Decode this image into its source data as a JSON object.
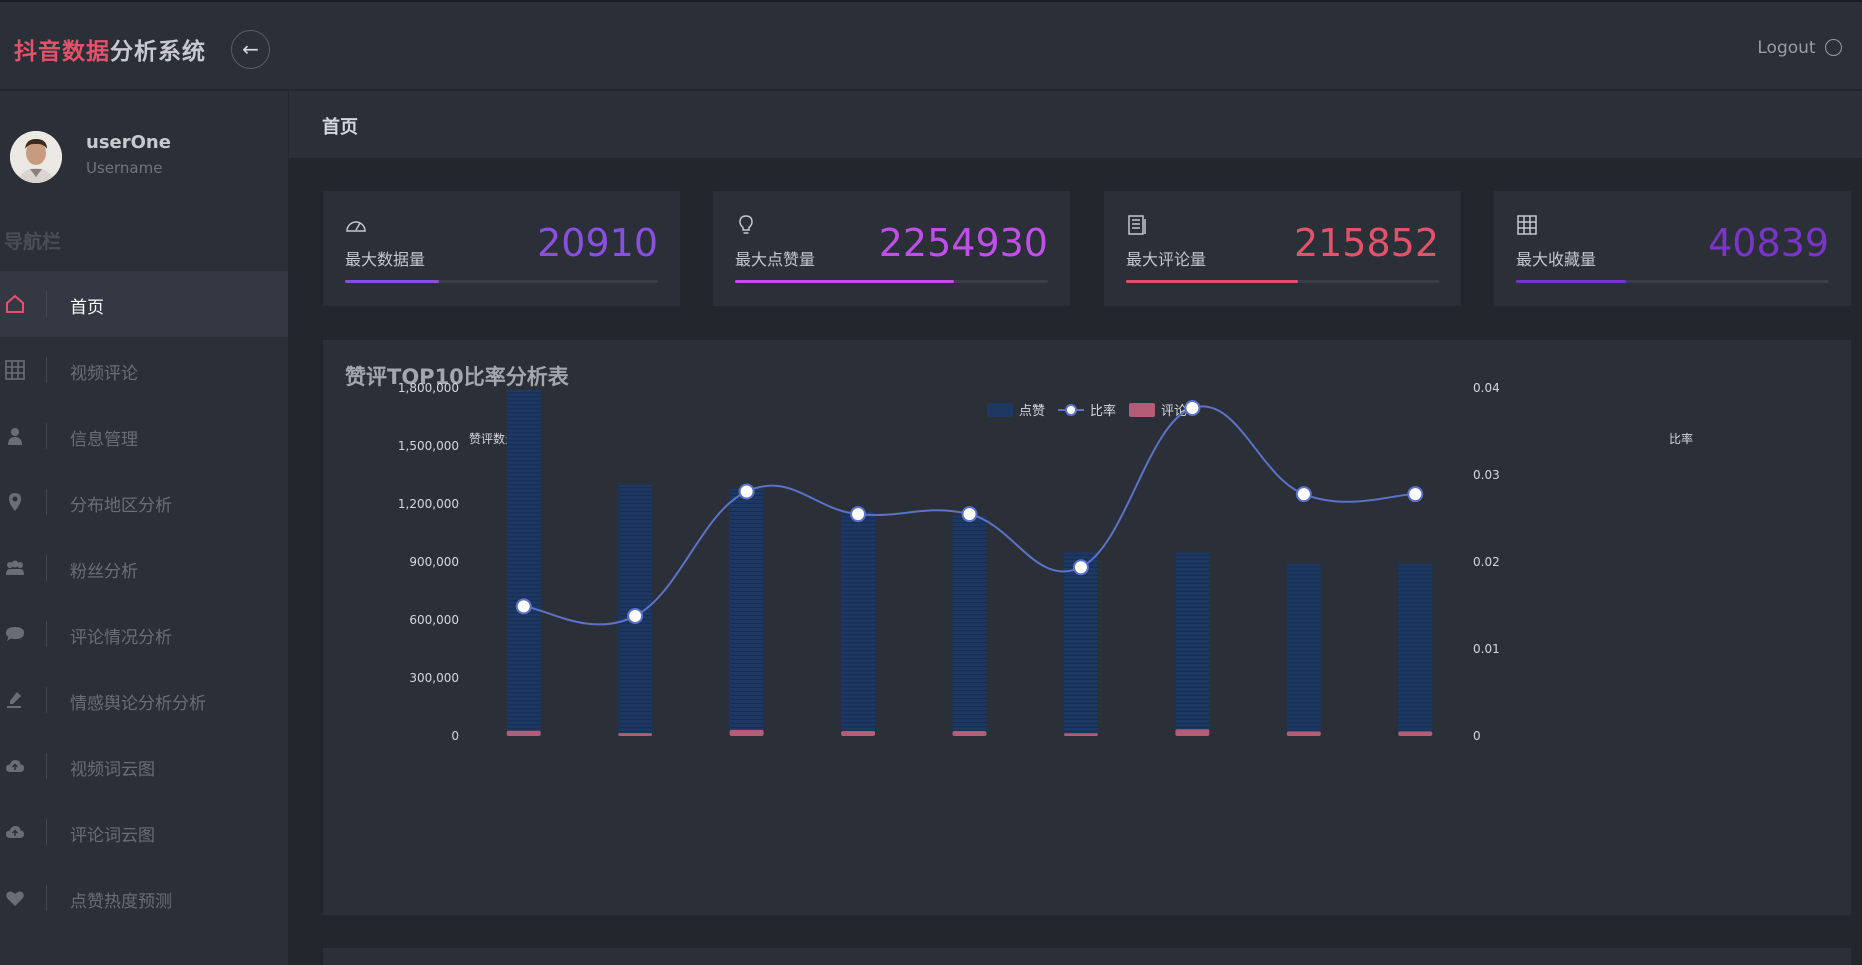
{
  "header": {
    "brand_part1": "抖音数据",
    "brand_part2": "分析系统",
    "logout_label": "Logout"
  },
  "user": {
    "name": "userOne",
    "role": "Username"
  },
  "sidebar": {
    "title": "导航栏",
    "items": [
      {
        "label": "首页",
        "icon": "home-icon",
        "active": true
      },
      {
        "label": "视频评论",
        "icon": "grid-icon"
      },
      {
        "label": "信息管理",
        "icon": "user-icon"
      },
      {
        "label": "分布地区分析",
        "icon": "map-marker-icon"
      },
      {
        "label": "粉丝分析",
        "icon": "users-icon"
      },
      {
        "label": "评论情况分析",
        "icon": "comment-icon"
      },
      {
        "label": "情感舆论分析分析",
        "icon": "pen-icon"
      },
      {
        "label": "视频词云图",
        "icon": "cloud-icon"
      },
      {
        "label": "评论词云图",
        "icon": "cloud-icon"
      },
      {
        "label": "点赞热度预测",
        "icon": "heart-icon"
      }
    ]
  },
  "breadcrumb": "首页",
  "stats": [
    {
      "label": "最大数据量",
      "value": "20910",
      "icon": "dashboard-icon",
      "color": "#8a4fe0",
      "progress": 0.3
    },
    {
      "label": "最大点赞量",
      "value": "2254930",
      "icon": "lightbulb-icon",
      "color": "#c04fe8",
      "progress": 0.7
    },
    {
      "label": "最大评论量",
      "value": "215852",
      "icon": "document-icon",
      "color": "#e2536b",
      "progress": 0.55
    },
    {
      "label": "最大收藏量",
      "value": "40839",
      "icon": "grid-icon",
      "color": "#7a35c8",
      "progress": 0.35
    }
  ],
  "chart_data": {
    "type": "bar",
    "title": "赞评TOP10比率分析表",
    "legend": [
      "点赞",
      "比率",
      "评论"
    ],
    "legend_position": "top-center",
    "ylabel_left": "赞评数量",
    "ylabel_right": "比率",
    "ylim_left": [
      0,
      1800000
    ],
    "ylim_right": [
      0,
      0.04
    ],
    "yticks_left": [
      "0",
      "300,000",
      "600,000",
      "900,000",
      "1,200,000",
      "1,500,000",
      "1,800,000"
    ],
    "yticks_right": [
      "0",
      "0.01",
      "0.02",
      "0.03",
      "0.04"
    ],
    "grid": false,
    "series": [
      {
        "name": "点赞",
        "type": "bar",
        "color": "#1d3863",
        "values": [
          1790000,
          1300000,
          1280000,
          1160000,
          1140000,
          950000,
          950000,
          890000,
          890000
        ]
      },
      {
        "name": "评论",
        "type": "bar",
        "color": "#b55c76",
        "values": [
          27000,
          15000,
          32000,
          26000,
          26000,
          14000,
          35000,
          24000,
          24000
        ]
      },
      {
        "name": "比率",
        "type": "line",
        "color": "#5b72c8",
        "values": [
          0.0149,
          0.0138,
          0.0281,
          0.0255,
          0.0255,
          0.0194,
          0.0377,
          0.0278,
          0.0278
        ]
      }
    ]
  }
}
